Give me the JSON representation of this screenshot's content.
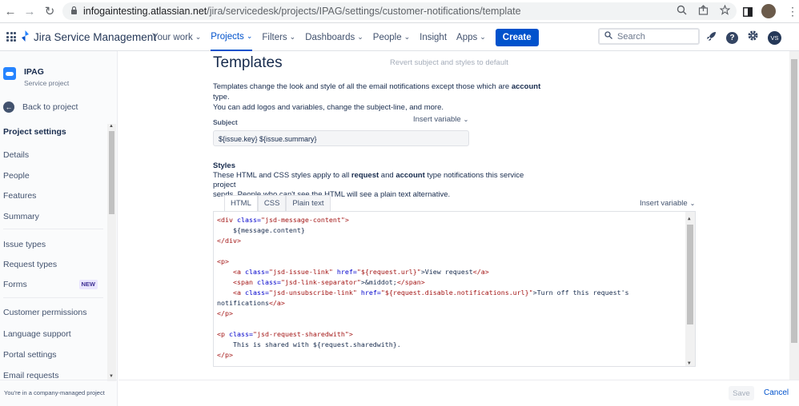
{
  "browser": {
    "back": "←",
    "forward": "→",
    "reload": "↻",
    "url_host": "infogaintesting.atlassian.net",
    "url_path": "/jira/servicedesk/projects/IPAG/settings/customer-notifications/template",
    "avatar_initial": "●",
    "menu": "⋮"
  },
  "topnav": {
    "brand": "Jira Service Management",
    "items": [
      {
        "label": "Your work",
        "chevron": "⌄"
      },
      {
        "label": "Projects",
        "chevron": "⌄"
      },
      {
        "label": "Filters",
        "chevron": "⌄"
      },
      {
        "label": "Dashboards",
        "chevron": "⌄"
      },
      {
        "label": "People",
        "chevron": "⌄"
      },
      {
        "label": "Insight",
        "chevron": ""
      },
      {
        "label": "Apps",
        "chevron": "⌄"
      }
    ],
    "create": "Create",
    "search_placeholder": "Search",
    "help": "?",
    "avatar": "VS"
  },
  "sidebar": {
    "project_name": "IPAG",
    "project_type": "Service project",
    "back": "Back to project",
    "section": "Project settings",
    "items": [
      {
        "label": "Details"
      },
      {
        "label": "People"
      },
      {
        "label": "Features"
      },
      {
        "label": "Summary"
      },
      {
        "label": "Issue types"
      },
      {
        "label": "Request types"
      },
      {
        "label": "Forms",
        "badge": "NEW"
      },
      {
        "label": "Customer permissions"
      },
      {
        "label": "Language support"
      },
      {
        "label": "Portal settings"
      },
      {
        "label": "Email requests"
      }
    ],
    "footer": "You're in a company-managed project"
  },
  "main": {
    "title": "Templates",
    "revert": "Revert subject and styles to default",
    "desc_1": "Templates change the look and style of all the email notifications except those which are ",
    "desc_bold": "account",
    "desc_2": " type.",
    "desc_3": "You can add logos and variables, change the subject-line, and more.",
    "subject_label": "Subject",
    "insert_variable": "Insert variable",
    "subject_value": "${issue.key} ${issue.summary}",
    "styles_heading": "Styles",
    "styles_desc_1": "These HTML and CSS styles apply to all ",
    "styles_bold_1": "request",
    "styles_and": " and ",
    "styles_bold_2": "account",
    "styles_desc_2": " type notifications this service project",
    "styles_desc_3": "sends. People who can't see the HTML will see a plain text alternative.",
    "tabs": [
      "HTML",
      "CSS",
      "Plain text"
    ],
    "save": "Save",
    "cancel": "Cancel"
  },
  "code": {
    "l1_open": "<div ",
    "l1_attr": "class=",
    "l1_val": "\"jsd-message-content\"",
    "l1_close": ">",
    "l2": "    ${message.content}",
    "l3": "</div>",
    "l5": "<p>",
    "l6_open": "    <a ",
    "l6_a1": "class=",
    "l6_v1": "\"jsd-issue-link\"",
    "l6_a2": " href=",
    "l6_v2": "\"${request.url}\"",
    "l6_text": ">View request",
    "l6_close": "</a>",
    "l7_open": "    <span ",
    "l7_a1": "class=",
    "l7_v1": "\"jsd-link-separator\"",
    "l7_text": ">&middot;",
    "l7_close": "</span>",
    "l8_open": "    <a ",
    "l8_a1": "class=",
    "l8_v1": "\"jsd-unsubscribe-link\"",
    "l8_a2": " href=",
    "l8_v2": "\"${request.disable.notifications.url}\"",
    "l8_text": ">Turn off this request's",
    "l9_text": "notifications",
    "l9_close": "</a>",
    "l10": "</p>",
    "l12_open": "<p ",
    "l12_attr": "class=",
    "l12_val": "\"jsd-request-sharedwith\"",
    "l12_close": ">",
    "l13": "    This is shared with ${request.sharedwith}.",
    "l14": "</p>"
  }
}
